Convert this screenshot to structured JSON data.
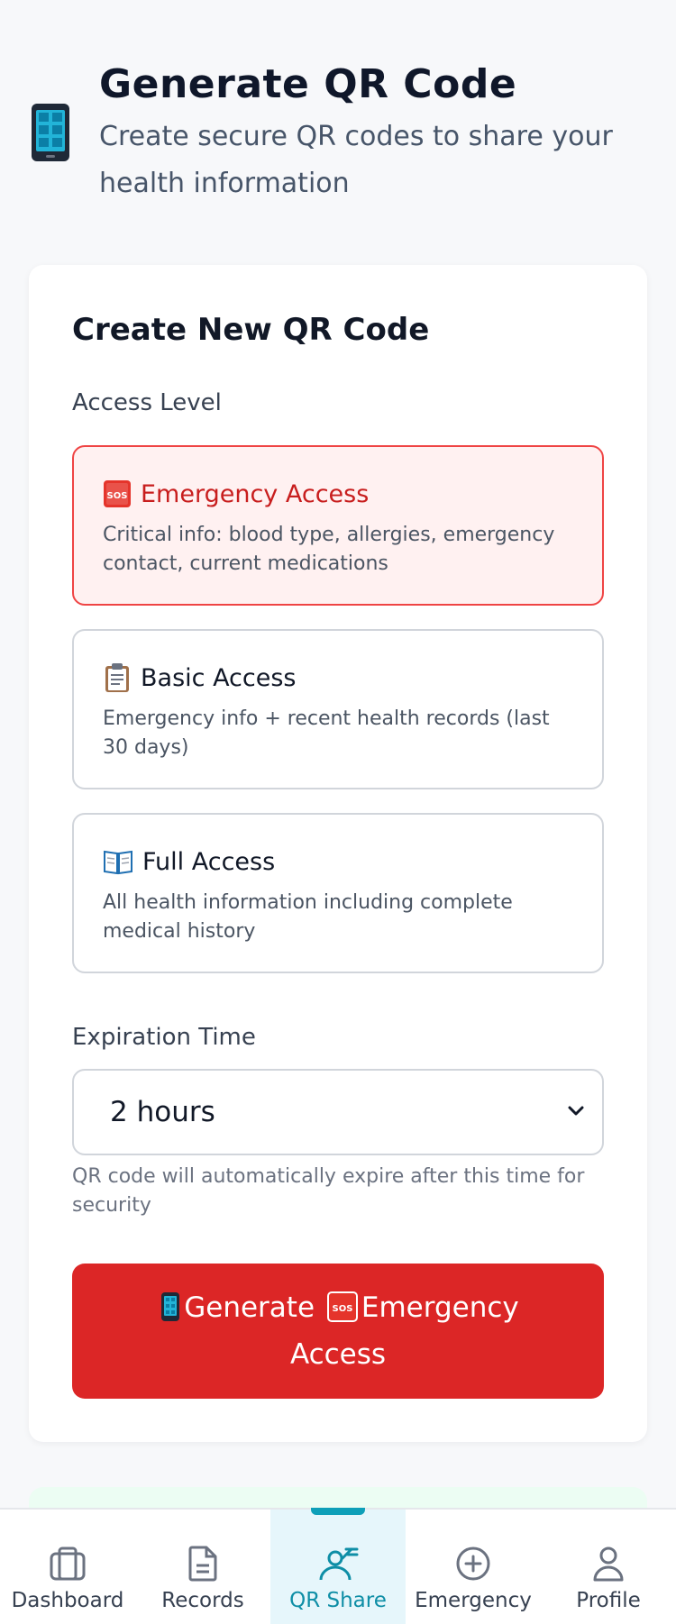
{
  "header": {
    "icon": "mobile-phone-icon",
    "title": "Generate QR Code",
    "subtitle": "Create secure QR codes to share your health information"
  },
  "card": {
    "title": "Create New QR Code",
    "access_label": "Access Level",
    "options": [
      {
        "icon": "sos-icon",
        "title": "Emergency Access",
        "description": "Critical info: blood type, allergies, emergency contact, current medications",
        "selected": true
      },
      {
        "icon": "clipboard-icon",
        "title": "Basic Access",
        "description": "Emergency info + recent health records (last 30 days)",
        "selected": false
      },
      {
        "icon": "open-book-icon",
        "title": "Full Access",
        "description": "All health information including complete medical history",
        "selected": false
      }
    ],
    "expiration_label": "Expiration Time",
    "expiration_value": "2 hours",
    "expiration_hint": "QR code will automatically expire after this time for security",
    "generate_prefix": "Generate",
    "generate_suffix": "Emergency Access"
  },
  "nav": {
    "items": [
      {
        "label": "Dashboard",
        "icon": "dashboard-icon",
        "active": false
      },
      {
        "label": "Records",
        "icon": "document-icon",
        "active": false
      },
      {
        "label": "QR Share",
        "icon": "qr-share-icon",
        "active": true
      },
      {
        "label": "Emergency",
        "icon": "plus-circle-icon",
        "active": false
      },
      {
        "label": "Profile",
        "icon": "user-icon",
        "active": false
      }
    ]
  },
  "colors": {
    "accent_red": "#dc2626",
    "selected_bg": "#fff1f1",
    "nav_active": "#0e8ea6"
  }
}
